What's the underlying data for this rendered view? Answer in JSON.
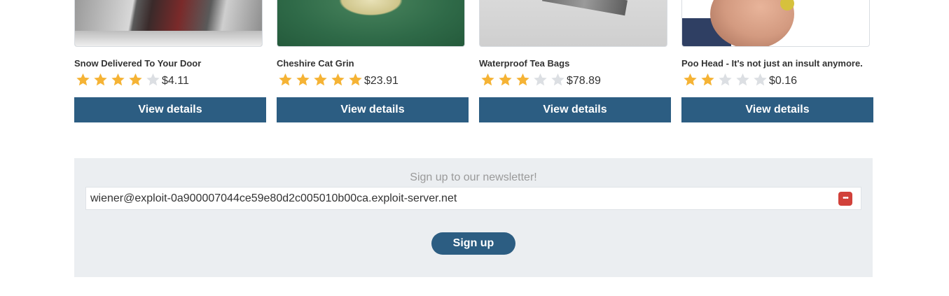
{
  "colors": {
    "star_filled": "#f5b335",
    "star_empty": "#dcdfe3",
    "button_bg": "#2c5d82",
    "newsletter_bg": "#ebeef1"
  },
  "products": [
    {
      "name": "Snow Delivered To Your Door",
      "rating": 4,
      "rating_max": 5,
      "price": "$4.11",
      "button_label": "View details"
    },
    {
      "name": "Cheshire Cat Grin",
      "rating": 5,
      "rating_max": 5,
      "price": "$23.91",
      "button_label": "View details"
    },
    {
      "name": "Waterproof Tea Bags",
      "rating": 3,
      "rating_max": 5,
      "price": "$78.89",
      "button_label": "View details"
    },
    {
      "name": "Poo Head - It's not just an insult anymore.",
      "rating": 2,
      "rating_max": 5,
      "price": "$0.16",
      "button_label": "View details"
    }
  ],
  "newsletter": {
    "title": "Sign up to our newsletter!",
    "email_value": "wiener@exploit-0a900007044ce59e80d2c005010b00ca.exploit-server.net",
    "password_manager_icon": "password-manager-icon",
    "signup_label": "Sign up"
  }
}
